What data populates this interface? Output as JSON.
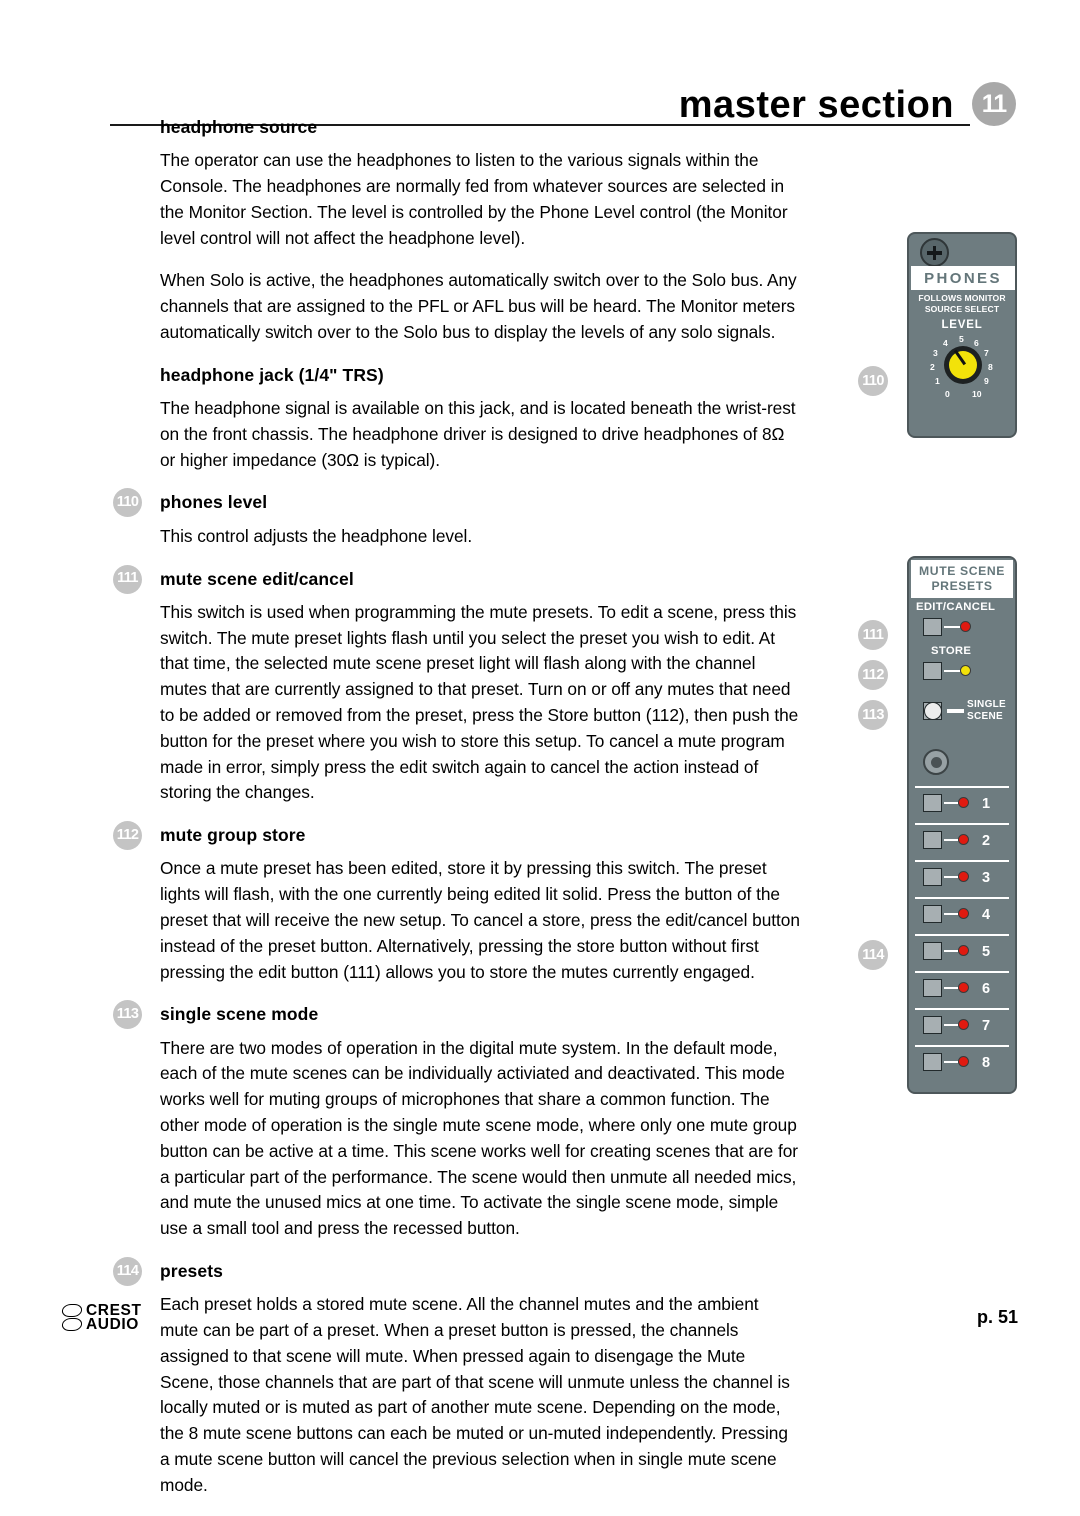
{
  "header": {
    "title": "master section",
    "badge": "11"
  },
  "sections": [
    {
      "id": "headphone-source",
      "bubble": null,
      "heading": "headphone source",
      "paragraphs": [
        "The operator can use the headphones to listen to the various signals within the Console. The headphones are normally fed from whatever sources are selected in the Monitor Section. The level is controlled by the Phone Level control (the Monitor level control will not affect the headphone level).",
        "When Solo is active, the headphones automatically switch over to the Solo bus. Any channels that are assigned to the PFL or AFL bus will be heard. The Monitor meters automatically switch over to the Solo bus to display the levels of any solo signals."
      ]
    },
    {
      "id": "headphone-jack",
      "bubble": null,
      "heading": "headphone jack  (1/4\" TRS)",
      "paragraphs": [
        "The headphone signal is available on this jack, and is located beneath the wrist-rest on the front chassis. The headphone driver is designed to drive headphones of 8Ω or higher impedance (30Ω is typical)."
      ]
    },
    {
      "id": "phones-level",
      "bubble": "110",
      "heading": "phones level",
      "paragraphs": [
        "This control adjusts the headphone level."
      ]
    },
    {
      "id": "mute-scene-edit-cancel",
      "bubble": "111",
      "heading": "mute scene edit/cancel",
      "paragraphs": [
        "This switch is used when programming the mute presets. To edit a scene, press this switch. The mute preset lights flash until you select the preset you wish to edit. At that time, the selected mute scene preset light will flash along with the channel mutes that are currently assigned to that preset.  Turn on or off any mutes that need to be added or removed from the preset, press the Store button (112), then push the button for the preset where you wish to store this setup. To cancel a mute program made in error, simply press the edit switch again to cancel the action instead of storing the changes."
      ]
    },
    {
      "id": "mute-group-store",
      "bubble": "112",
      "heading": "mute group store",
      "paragraphs": [
        "Once a mute preset has been edited, store it by pressing this switch. The preset lights will flash, with the one currently being edited lit solid.  Press the button of the preset that will receive the new setup. To cancel a store, press the edit/cancel button instead of the preset button. Alternatively, pressing the store button without first pressing the edit button (111) allows you to store the mutes currently engaged."
      ]
    },
    {
      "id": "single-scene-mode",
      "bubble": "113",
      "heading": "single scene mode",
      "paragraphs": [
        "There are two modes of operation in the digital mute system.  In the default mode, each of the mute scenes can be individually activiated and deactivated. This mode works well for muting groups of microphones that share a common function. The other mode of operation is the single mute scene mode, where only one mute group button can be active at a time. This scene works well for creating scenes that are for a particular part of the performance. The scene would then unmute all needed mics, and mute the unused mics at one time. To activate the single scene mode, simple use a small tool and press the recessed button."
      ]
    },
    {
      "id": "presets",
      "bubble": "114",
      "heading": "presets",
      "paragraphs": [
        "Each preset holds a stored mute scene.  All the channel mutes and the ambient mute can be part of a preset.  When a preset button is pressed, the channels assigned to that scene will mute.  When pressed again to disengage the Mute Scene, those channels that are part of that scene will unmute unless the channel is locally muted or is muted as part of another mute scene. Depending on the mode, the 8 mute scene buttons can each be muted or un-muted independently. Pressing a mute scene button will cancel the previous selection when in single mute scene mode."
      ]
    }
  ],
  "callouts": {
    "phones_level": "110",
    "edit_cancel": "111",
    "store": "112",
    "single_scene": "113",
    "presets": "114"
  },
  "phones_panel": {
    "title": "PHONES",
    "subtitle_line1": "FOLLOWS MONITOR",
    "subtitle_line2": "SOURCE SELECT",
    "level_caption": "LEVEL",
    "knob_ticks": [
      "0",
      "1",
      "2",
      "3",
      "4",
      "5",
      "6",
      "7",
      "8",
      "9",
      "10"
    ],
    "knob_color": "#f2e20a",
    "panel_color": "#6e7c80"
  },
  "mute_panel": {
    "title_line1": "MUTE SCENE",
    "title_line2": "PRESETS",
    "edit_cancel_label": "EDIT/CANCEL",
    "store_label": "STORE",
    "single_scene_line1": "SINGLE",
    "single_scene_line2": "SCENE",
    "preset_numbers": [
      "1",
      "2",
      "3",
      "4",
      "5",
      "6",
      "7",
      "8"
    ],
    "led_red": "#e01a10",
    "led_yellow": "#f2e20a"
  },
  "footer": {
    "brand_line1": "CREST",
    "brand_line2": "AUDIO",
    "page": "p. 51"
  }
}
